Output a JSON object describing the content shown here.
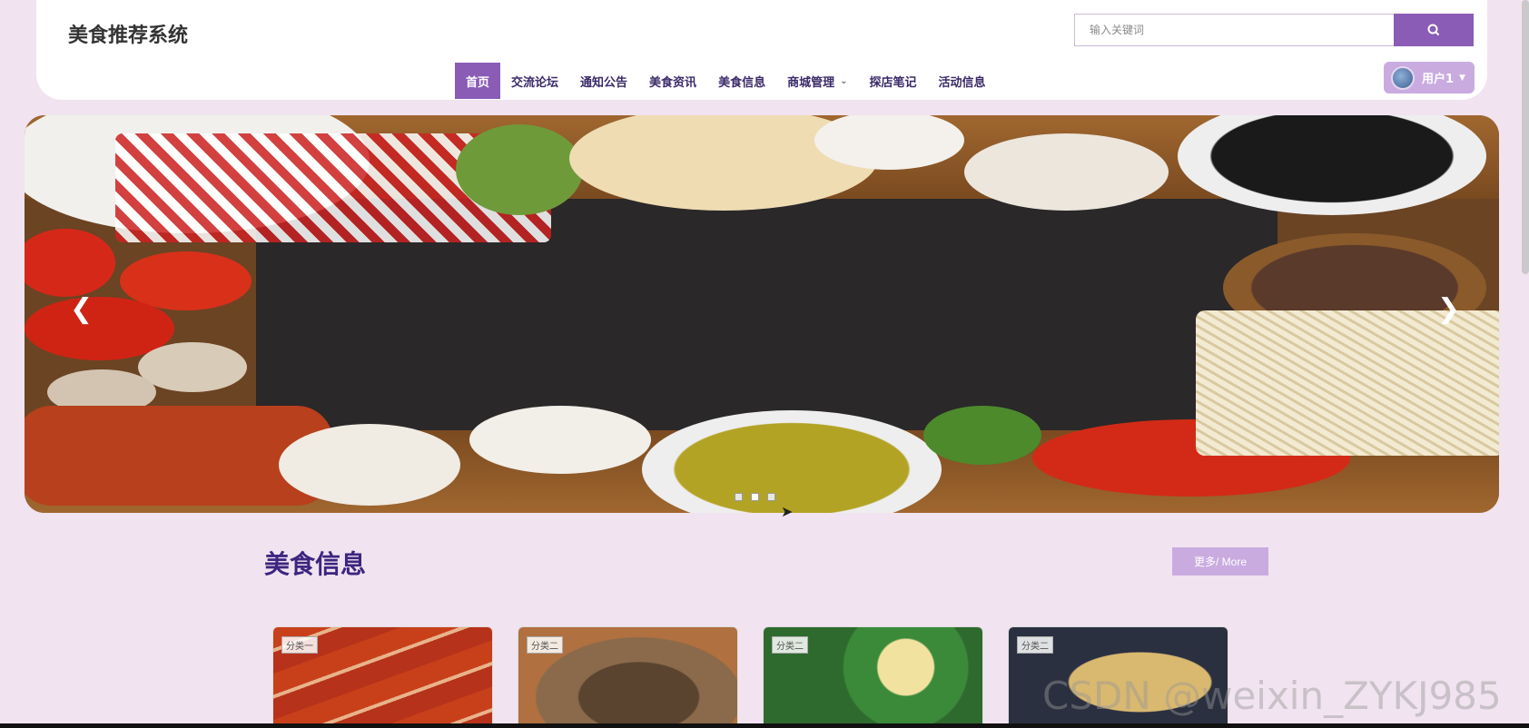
{
  "header": {
    "site_title": "美食推荐系统",
    "search_placeholder": "输入关键词",
    "search_icon": "search-icon",
    "nav": [
      {
        "label": "首页",
        "active": true
      },
      {
        "label": "交流论坛"
      },
      {
        "label": "通知公告"
      },
      {
        "label": "美食资讯"
      },
      {
        "label": "美食信息"
      },
      {
        "label": "商城管理",
        "has_dropdown": true
      },
      {
        "label": "探店笔记"
      },
      {
        "label": "活动信息"
      }
    ],
    "user": {
      "label": "用户1",
      "avatar": "avatar-icon"
    }
  },
  "banner": {
    "prev_icon": "chevron-left-icon",
    "next_icon": "chevron-right-icon",
    "slide_count": 3,
    "active_slide": 2
  },
  "section": {
    "title": "美食信息",
    "more_label": "更多/ More"
  },
  "cards": [
    {
      "tag": "分类一"
    },
    {
      "tag": "分类二"
    },
    {
      "tag": "分类二"
    },
    {
      "tag": "分类二"
    }
  ],
  "watermark": "CSDN @weixin_ZYKJ985",
  "colors": {
    "accent": "#8a5cb6",
    "accent_light": "#c9abe0",
    "page_bg": "#f1e3ef",
    "nav_text": "#3a2a6a",
    "title_text": "#3d2580"
  }
}
